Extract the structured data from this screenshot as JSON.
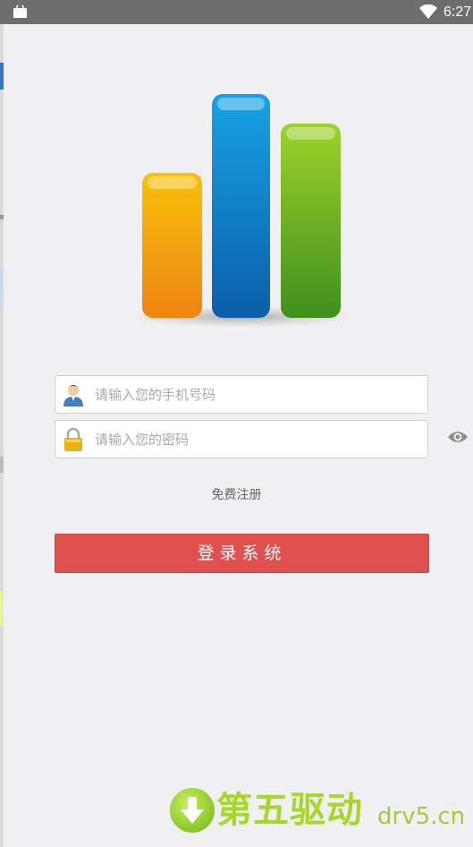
{
  "status_bar": {
    "time": "6:27"
  },
  "login": {
    "phone_placeholder": "请输入您的手机号码",
    "password_placeholder": "请输入您的密码",
    "register_link": "免费注册",
    "login_button": "登录系统"
  },
  "watermark": {
    "cn": "第五驱动",
    "url": "drv5.cn"
  },
  "colors": {
    "status_bar": "#6d6d6d",
    "background": "#f0f0f2",
    "login_button": "#e0504e",
    "logo_bars": [
      "#f29b0f",
      "#0a7fc8",
      "#6cb31c"
    ]
  }
}
